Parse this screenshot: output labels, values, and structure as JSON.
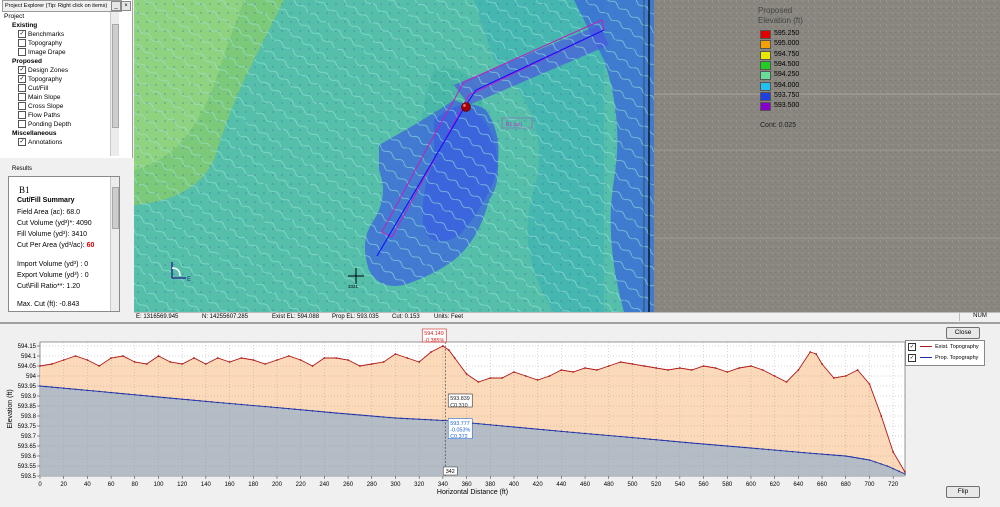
{
  "explorer": {
    "title": "Project Explorer (Tip: Right click on items)",
    "min": "_",
    "close": "×",
    "items": [
      {
        "label": "Project",
        "type": "root"
      },
      {
        "label": "Existing",
        "type": "header"
      },
      {
        "label": "Benchmarks",
        "type": "check",
        "checked": true
      },
      {
        "label": "Topography",
        "type": "check",
        "checked": false
      },
      {
        "label": "Image Drape",
        "type": "check",
        "checked": false
      },
      {
        "label": "Proposed",
        "type": "header"
      },
      {
        "label": "Design Zones",
        "type": "check",
        "checked": true
      },
      {
        "label": "Topography",
        "type": "check",
        "checked": true
      },
      {
        "label": "Cut/Fill",
        "type": "check",
        "checked": false
      },
      {
        "label": "Main Slope",
        "type": "check",
        "checked": false
      },
      {
        "label": "Cross Slope",
        "type": "check",
        "checked": false
      },
      {
        "label": "Flow Paths",
        "type": "check",
        "checked": false
      },
      {
        "label": "Ponding Depth",
        "type": "check",
        "checked": false
      },
      {
        "label": "Miscellaneous",
        "type": "header"
      },
      {
        "label": "Annotations",
        "type": "check",
        "checked": true
      }
    ]
  },
  "results": {
    "label": "Results",
    "zone": "B1",
    "heading": "Cut/Fill Summary",
    "field_area": "Field Area (ac): 68.0",
    "cut_volume": "Cut Volume (yd³)*: 4090",
    "fill_volume": "Fill Volume (yd³): 3410",
    "cut_per_area_label": "Cut Per Area (yd³/ac):",
    "cut_per_area_value": "60",
    "import_volume": "Import Volume (yd³) : 0",
    "export_volume": "Export Volume (yd³) : 0",
    "ratio": "Cut\\Fill Ratio**: 1.20",
    "max_cut": "Max. Cut (ft): -0.843"
  },
  "map": {
    "compass_label": "E",
    "crosshair_label": "3321",
    "zone_label": "B1 (ac)"
  },
  "legend": {
    "title_line1": "Proposed",
    "title_line2": "Elevation (ft)",
    "entries": [
      {
        "value": "595.250",
        "color": "#e00000"
      },
      {
        "value": "595.000",
        "color": "#f5a000"
      },
      {
        "value": "594.750",
        "color": "#e8e800"
      },
      {
        "value": "594.500",
        "color": "#22cc22"
      },
      {
        "value": "594.250",
        "color": "#66dd99"
      },
      {
        "value": "594.000",
        "color": "#22c0ee"
      },
      {
        "value": "593.750",
        "color": "#1f3fe0"
      },
      {
        "value": "593.500",
        "color": "#8800cc"
      }
    ],
    "cont": "Cont: 0.025"
  },
  "status": {
    "easting": "E: 1316569.945",
    "northing": "N: 14255607.285",
    "exist_el": "Exist EL: 594.088",
    "prop_el": "Prop EL: 593.035",
    "cut": "Cut: 0.153",
    "units": "Units: Feet",
    "num": "NUM"
  },
  "profile": {
    "close_label": "Close",
    "flip_label": "Flip",
    "legend": [
      {
        "label": "Exist. Topography",
        "checked": true,
        "color": "#b01818"
      },
      {
        "label": "Prop. Topography",
        "checked": true,
        "color": "#1a2fa8"
      }
    ],
    "cursor_top": "594.149",
    "cursor_top_sub": "-0.385%",
    "cursor_mid": "593.839",
    "cursor_mid_sub": "C0.310",
    "cursor_prop": "593.777",
    "cursor_prop_sub": "-0.053%",
    "cursor_prop_sub2": "C0.372",
    "cursor_x": "342"
  },
  "chart_data": {
    "type": "area",
    "xlabel": "Horizontal Distance (ft)",
    "ylabel": "Elevation (ft)",
    "xlim": [
      0,
      730
    ],
    "ylim": [
      593.5,
      594.17
    ],
    "x_ticks": [
      0,
      20,
      40,
      60,
      80,
      100,
      120,
      140,
      160,
      180,
      200,
      220,
      240,
      260,
      280,
      300,
      320,
      340,
      360,
      380,
      400,
      420,
      440,
      460,
      480,
      500,
      520,
      540,
      560,
      580,
      600,
      620,
      640,
      660,
      680,
      700,
      720
    ],
    "y_ticks": [
      593.5,
      593.55,
      593.6,
      593.65,
      593.7,
      593.75,
      593.8,
      593.85,
      593.9,
      593.95,
      594,
      594.05,
      594.1,
      594.15
    ],
    "y_tick_labels": [
      "593.5",
      "593.55",
      "593.6",
      "593.65",
      "593.7",
      "593.75",
      "593.8",
      "593.85",
      "593.9",
      "593.95",
      "594",
      "594.05",
      "594.1",
      "594.15"
    ],
    "cursor_x": 342,
    "series": [
      {
        "name": "Exist. Topography",
        "color": "#b01818",
        "fill": "#fcd9b8",
        "x": [
          0,
          10,
          20,
          30,
          40,
          50,
          60,
          70,
          80,
          90,
          100,
          110,
          120,
          130,
          140,
          150,
          160,
          170,
          180,
          190,
          200,
          210,
          220,
          230,
          240,
          250,
          260,
          270,
          280,
          290,
          300,
          310,
          320,
          330,
          340,
          345,
          350,
          360,
          370,
          380,
          390,
          400,
          410,
          420,
          430,
          440,
          450,
          460,
          470,
          480,
          490,
          500,
          510,
          520,
          530,
          540,
          550,
          560,
          570,
          580,
          590,
          600,
          610,
          620,
          630,
          640,
          650,
          655,
          660,
          670,
          680,
          690,
          700,
          710,
          720,
          730
        ],
        "y": [
          594.05,
          594.06,
          594.08,
          594.1,
          594.08,
          594.05,
          594.09,
          594.1,
          594.07,
          594.06,
          594.1,
          594.07,
          594.06,
          594.09,
          594.06,
          594.09,
          594.07,
          594.09,
          594.08,
          594.06,
          594.08,
          594.1,
          594.08,
          594.05,
          594.09,
          594.09,
          594.08,
          594.05,
          594.06,
          594.07,
          594.11,
          594.09,
          594.07,
          594.12,
          594.15,
          594.13,
          594.09,
          594.01,
          593.97,
          593.99,
          593.99,
          594.02,
          594.0,
          593.98,
          594.0,
          594.03,
          594.02,
          594.04,
          594.03,
          594.05,
          594.07,
          594.06,
          594.05,
          594.04,
          594.03,
          594.04,
          594.03,
          594.05,
          594.04,
          594.02,
          594.04,
          594.05,
          594.03,
          594.0,
          593.97,
          594.03,
          594.12,
          594.11,
          594.06,
          593.99,
          594.0,
          594.03,
          593.96,
          593.8,
          593.62,
          593.52
        ],
        "markers": true
      },
      {
        "name": "Prop. Topography",
        "color": "#1a2fa8",
        "fill": "#b4bcc6",
        "x": [
          0,
          50,
          100,
          150,
          200,
          250,
          300,
          342,
          400,
          450,
          500,
          550,
          600,
          650,
          680,
          700,
          715,
          730
        ],
        "y": [
          593.95,
          593.923,
          593.895,
          593.868,
          593.842,
          593.815,
          593.79,
          593.777,
          593.745,
          593.718,
          593.692,
          593.665,
          593.64,
          593.614,
          593.6,
          593.58,
          593.55,
          593.51
        ],
        "markers": true
      }
    ]
  }
}
